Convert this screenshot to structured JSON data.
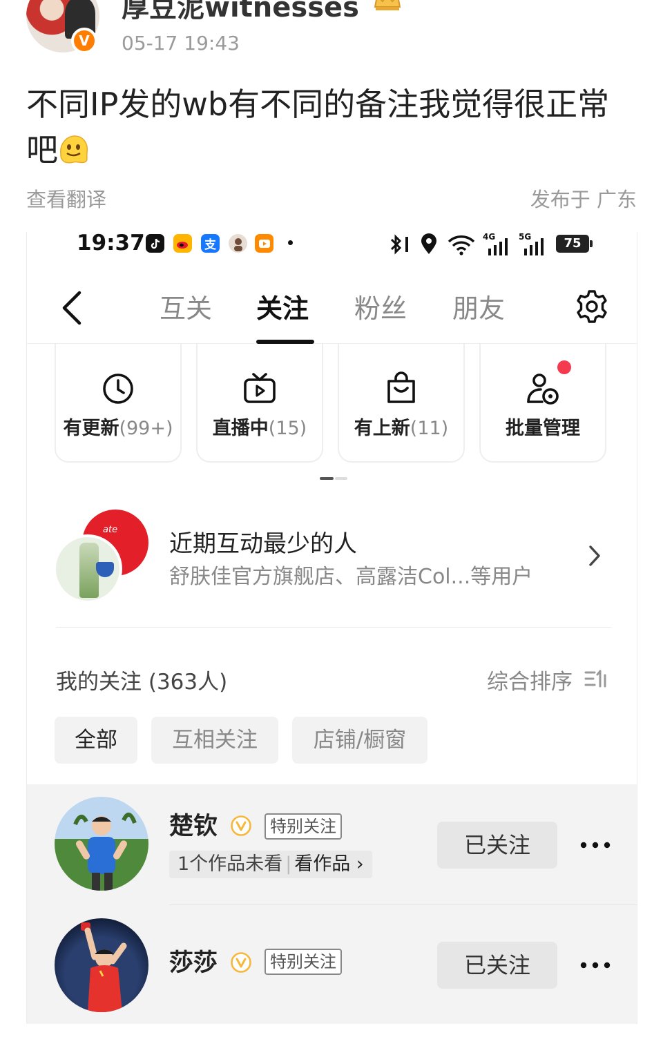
{
  "post": {
    "author": "厚豆泥witnesses",
    "verified_badge": "V",
    "time": "05-17 19:43",
    "text": "不同IP发的wb有不同的备注我觉得很正常吧",
    "translate_label": "查看翻译",
    "location": "发布于 广东",
    "emoji_icon": "melting-face-emoji"
  },
  "phone": {
    "status_bar": {
      "time": "19:37",
      "app_icons": [
        "douyin-icon",
        "weibo-icon",
        "alipay-icon",
        "avatar-app-icon",
        "video-app-icon"
      ],
      "alipay_glyph": "支",
      "battery": "75",
      "network_a": "4G",
      "network_b": "5G"
    },
    "nav": {
      "tabs": [
        {
          "label": "互关"
        },
        {
          "label": "关注"
        },
        {
          "label": "粉丝"
        },
        {
          "label": "朋友"
        }
      ],
      "active_tab": "关注"
    },
    "cards": [
      {
        "label": "有更新",
        "count": "(99+)",
        "icon": "clock-icon"
      },
      {
        "label": "直播中",
        "count": "(15)",
        "icon": "tv-icon"
      },
      {
        "label": "有上新",
        "count": "(11)",
        "icon": "shopping-bag-icon"
      },
      {
        "label": "批量管理",
        "count": "",
        "icon": "user-manage-icon"
      }
    ],
    "least_interaction": {
      "title": "近期互动最少的人",
      "subtitle": "舒肤佳官方旗舰店、高露洁Col...等用户",
      "brand_text": "ate"
    },
    "following": {
      "count_label": "我的关注 (363人)",
      "sort_label": "综合排序"
    },
    "filters": [
      {
        "label": "全部",
        "active": true
      },
      {
        "label": "互相关注",
        "active": false
      },
      {
        "label": "店铺/橱窗",
        "active": false
      }
    ],
    "users": [
      {
        "name": "楚钦",
        "tag": "特别关注",
        "unwatched": "1个作品未看",
        "watch_link": "看作品 ›",
        "button": "已关注"
      },
      {
        "name": "莎莎",
        "tag": "特别关注",
        "button": "已关注"
      }
    ]
  },
  "colors": {
    "accent_orange": "#ff7d00",
    "badge_red": "#f43a4f",
    "vmark_yellow": "#f5b83b",
    "text_gray": "#888888"
  }
}
